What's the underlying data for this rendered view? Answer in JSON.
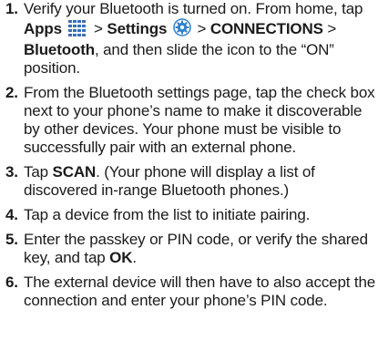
{
  "steps": [
    {
      "number": "1.",
      "parts": {
        "t1": "Verify your Bluetooth is turned on. From home, tap ",
        "b1": "Apps",
        "t2": " > ",
        "b2": "Settings",
        "t3": " > ",
        "b3": "CONNECTIONS",
        "t4": " > ",
        "b4": "Bluetooth",
        "t5": ", and then slide the icon to the “ON” position."
      },
      "icons": [
        "apps-grid-icon",
        "settings-gear-icon"
      ]
    },
    {
      "number": "2.",
      "parts": {
        "t1": "From the Bluetooth settings page, tap the check box next to your phone’s name to make it discoverable by other devices. Your phone must be visible to successfully pair with an external phone."
      }
    },
    {
      "number": "3.",
      "parts": {
        "t1": "Tap ",
        "b1": "SCAN",
        "t2": ". (Your phone will display a list of discovered in-range Bluetooth phones.)"
      }
    },
    {
      "number": "4.",
      "parts": {
        "t1": "Tap a device from the list to initiate pairing."
      }
    },
    {
      "number": "5.",
      "parts": {
        "t1": "Enter the passkey or PIN code, or verify the shared key, and tap ",
        "b1": "OK",
        "t2": "."
      }
    },
    {
      "number": "6.",
      "parts": {
        "t1": "The external device will then have to also accept the connection and enter your phone’s PIN code."
      }
    }
  ],
  "colors": {
    "text": "#1b1b1b",
    "apps_icon": "#3b6fb6",
    "settings_icon": "#2f80c9"
  }
}
